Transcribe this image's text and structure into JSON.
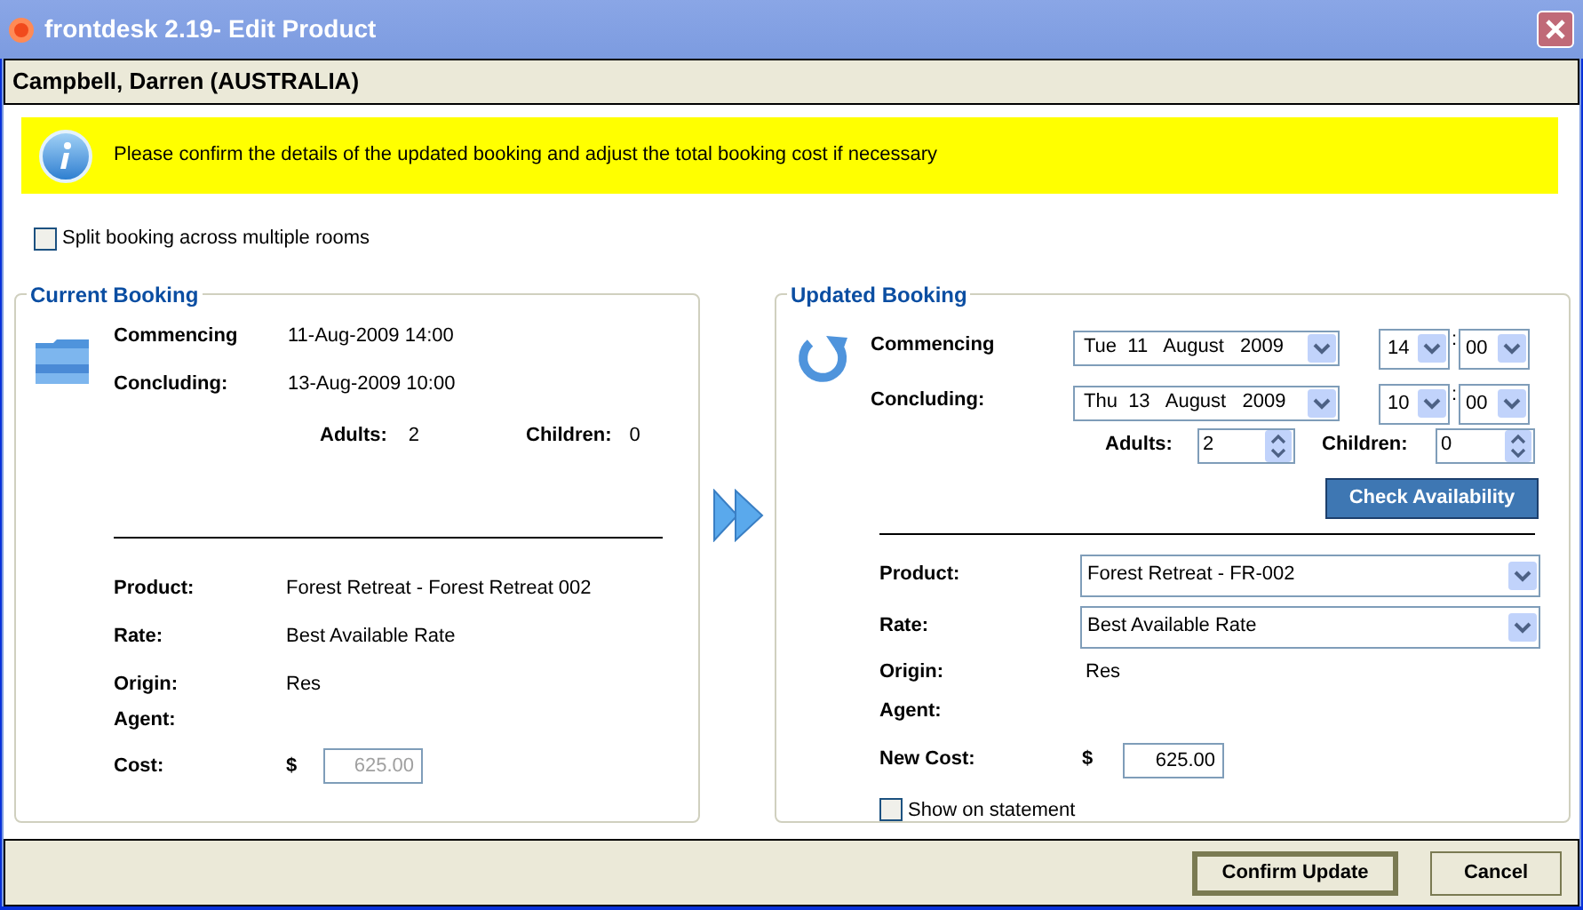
{
  "window": {
    "title": "frontdesk 2.19- Edit Product"
  },
  "customer": "Campbell, Darren (AUSTRALIA)",
  "notice": "Please confirm the details of the updated booking and adjust the total booking cost if necessary",
  "split_booking": {
    "label": "Split booking across multiple rooms",
    "checked": false
  },
  "current_booking": {
    "title": "Current Booking",
    "dates": [
      {
        "label": "Commencing",
        "value": "11-Aug-2009 14:00"
      },
      {
        "label": "Concluding:",
        "value": "13-Aug-2009 10:00"
      }
    ],
    "adults": {
      "label": "Adults:",
      "value": "2"
    },
    "children": {
      "label": "Children:",
      "value": "0"
    },
    "details": [
      {
        "label": "Product:",
        "value": "Forest Retreat - Forest Retreat 002"
      },
      {
        "label": "Rate:",
        "value": "Best Available Rate"
      },
      {
        "label": "Origin:",
        "value": "Res"
      },
      {
        "label": "Agent:"
      }
    ],
    "cost": {
      "label": "Cost:",
      "currency": "$",
      "value": "625.00",
      "disabled": true
    }
  },
  "updated_booking": {
    "title": "Updated Booking",
    "dates": [
      {
        "label": "Commencing",
        "date": "Tue  11   August   2009",
        "hour": "14",
        "separator": ":",
        "minute": "00"
      },
      {
        "label": "Concluding:",
        "date": "Thu  13   August   2009",
        "hour": "10",
        "separator": ":",
        "minute": "00"
      }
    ],
    "adults": {
      "label": "Adults:",
      "value": "2"
    },
    "children": {
      "label": "Children:",
      "value": "0"
    },
    "check_button": "Check Availability",
    "details": [
      {
        "label": "Product:",
        "kind": "select",
        "value": "Forest Retreat - FR-002"
      },
      {
        "label": "Rate:",
        "kind": "select",
        "value": "Best Available Rate"
      },
      {
        "label": "Origin:",
        "kind": "text",
        "value": "Res"
      },
      {
        "label": "Agent:",
        "kind": "text"
      }
    ],
    "cost": {
      "label": "New Cost:",
      "currency": "$",
      "value": "625.00",
      "disabled": false
    },
    "show_on_statement": {
      "label": "Show on statement",
      "checked": false
    }
  },
  "buttons": [
    {
      "label": "Confirm Update",
      "default": true
    },
    {
      "label": "Cancel",
      "default": false
    }
  ]
}
